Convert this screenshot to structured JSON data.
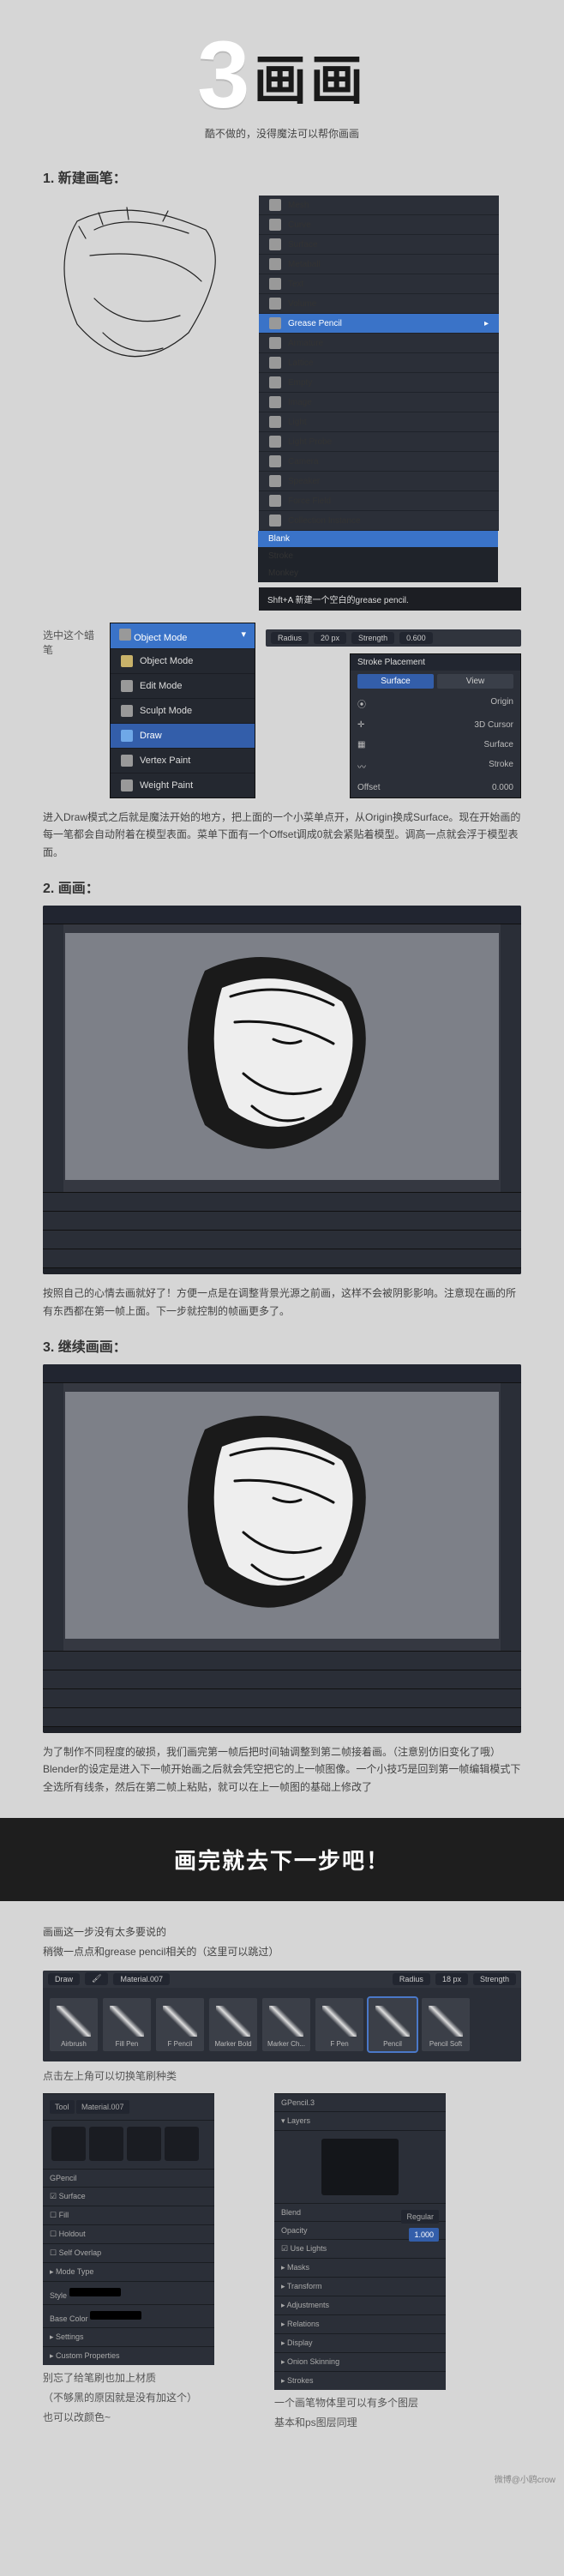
{
  "hero": {
    "num": "3",
    "title": "画画",
    "subtitle": "酷不做的，没得魔法可以帮你画画"
  },
  "s1": {
    "h": "1. 新建画笔：",
    "addmenu": [
      "Mesh",
      "Curve",
      "Surface",
      "Metaball",
      "Text",
      "Volume",
      "Grease Pencil",
      "Armature",
      "Lattice",
      "Empty",
      "Image",
      "Light",
      "Light Probe",
      "Camera",
      "Speaker",
      "Force Field",
      "Collection Instance"
    ],
    "addmenu_sel": "Grease Pencil",
    "submenu": [
      "Blank",
      "Stroke",
      "Monkey"
    ],
    "submenu_sel": "Blank",
    "hint": "Shft+A 新建一个空白的grease pencil.",
    "pick_label": "选中这个蜡笔",
    "modes_title": "Object Mode",
    "modes": [
      "Object Mode",
      "Edit Mode",
      "Sculpt Mode",
      "Draw",
      "Vertex Paint",
      "Weight Paint"
    ],
    "modes_sel": "Draw",
    "topbar": {
      "radius_l": "Radius",
      "radius_v": "20 px",
      "strength_l": "Strength",
      "strength_v": "0.600"
    },
    "panel": {
      "title": "Stroke Placement",
      "opts1": [
        "Surface",
        "View"
      ],
      "opts1_sel": "Surface",
      "opts2": [
        "Origin",
        "3D Cursor",
        "Surface",
        "Stroke"
      ],
      "offset_l": "Offset",
      "offset_v": "0.000"
    },
    "para": "进入Draw模式之后就是魔法开始的地方，把上面的一个小菜单点开，从Origin换成Surface。现在开始画的每一笔都会自动附着在模型表面。菜单下面有一个Offset调成0就会紧贴着模型。调高一点就会浮于模型表面。"
  },
  "s2": {
    "h": "2. 画画：",
    "para": "按照自己的心情去画就好了！方便一点是在调整背景光源之前画，这样不会被阴影影响。注意现在画的所有东西都在第一帧上面。下一步就控制的帧画更多了。"
  },
  "s3": {
    "h": "3. 继续画画：",
    "para": "为了制作不同程度的破损，我们画完第一帧后把时间轴调整到第二帧接着画。（注意别仿旧变化了哦）Blender的设定是进入下一帧开始画之后就会凭空把它的上一帧图像。一个小技巧是回到第一帧编辑模式下全选所有线条，然后在第二帧上粘贴，就可以在上一帧图的基础上修改了"
  },
  "bar": "画完就去下一步吧！",
  "extra": {
    "intro1": "画画这一步没有太多要说的",
    "intro2": "稍微一点点和grease pencil相关的（这里可以跳过）",
    "brushbar_header": {
      "mode": "Draw",
      "mat": "Material.007",
      "radius_l": "Radius",
      "radius_v": "18 px",
      "strength_l": "Strength"
    },
    "brushes": [
      "Airbrush",
      "Fill Pen",
      "F Pencil",
      "Marker Bold",
      "Marker Ch...",
      "F Pen",
      "Pencil",
      "Pencil Soft"
    ],
    "brushes_sel": "Pencil",
    "brush_caption": "点击左上角可以切换笔刷种类",
    "left_panel": {
      "tabs": [
        "Tool",
        "Material.007"
      ],
      "header": "GPencil",
      "items": [
        "Surface",
        "Fill",
        "Holdout",
        "Self Overlap"
      ],
      "sections": [
        "Mode Type",
        "Style",
        "Base Color",
        "Settings",
        "Custom Properties"
      ]
    },
    "right_panel": {
      "header": "GPencil.3",
      "section1": "Layers",
      "cols": [
        "Blend",
        "Opacity",
        "Use Lights"
      ],
      "opacity": "1.000",
      "section2": [
        "Masks",
        "Transform",
        "Adjustments",
        "Relations",
        "Display",
        "Onion Skinning",
        "Strokes"
      ]
    },
    "cap_left1": "别忘了给笔刷也加上材质",
    "cap_left2": "（不够黑的原因就是没有加这个）",
    "cap_left3": "也可以改颜色~",
    "cap_right1": "一个画笔物体里可以有多个图层",
    "cap_right2": "基本和ps图层同理"
  },
  "footer": "微博@小鸥crow"
}
